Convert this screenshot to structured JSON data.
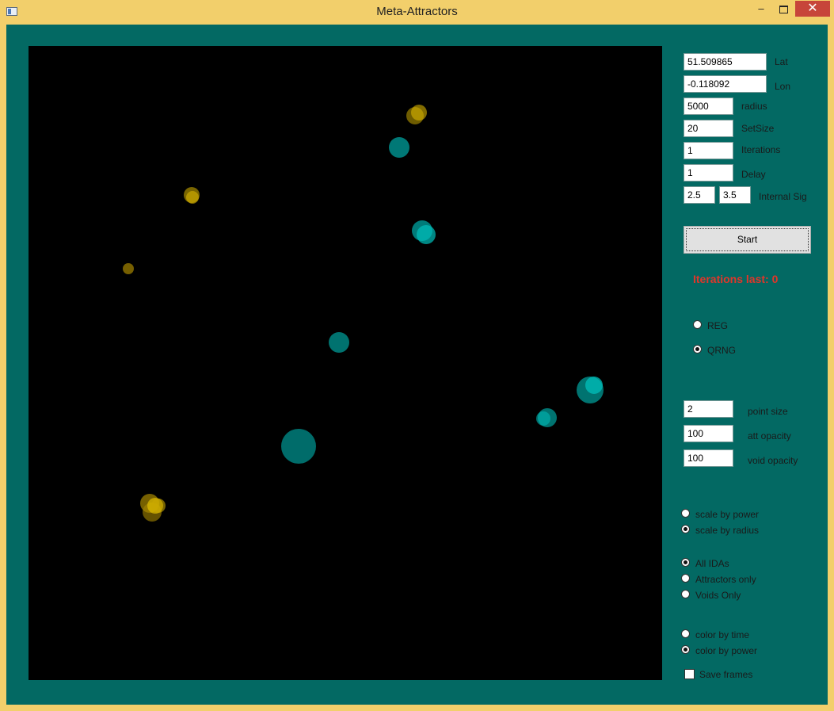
{
  "window": {
    "title": "Meta-Attractors",
    "minimize": "–",
    "close": "✕"
  },
  "colors": {
    "background": "#036963",
    "attractor": "#d4b000",
    "void": "#00b3b0",
    "error_text": "#e0362a"
  },
  "inputs": {
    "lat": {
      "value": "51.509865",
      "label": "Lat"
    },
    "lon": {
      "value": "-0.118092",
      "label": "Lon"
    },
    "radius": {
      "value": "5000",
      "label": "radius"
    },
    "setsize": {
      "value": "20",
      "label": "SetSize"
    },
    "iterations": {
      "value": "1",
      "label": "Iterations"
    },
    "delay": {
      "value": "1",
      "label": "Delay"
    },
    "internal_sig": {
      "value1": "2.5",
      "value2": "3.5",
      "label": "Internal Sig"
    }
  },
  "start_label": "Start",
  "iterations_last": "Iterations last: 0",
  "rng": {
    "reg": "REG",
    "qrng": "QRNG",
    "selected": "QRNG"
  },
  "display": {
    "point_size": {
      "value": "2",
      "label": "point size"
    },
    "att_opacity": {
      "value": "100",
      "label": "att opacity"
    },
    "void_opacity": {
      "value": "100",
      "label": "void opacity"
    }
  },
  "scale": {
    "power": "scale by power",
    "radius": "scale by radius",
    "selected": "scale by radius"
  },
  "filter": {
    "all": "All IDAs",
    "attractors": "Attractors only",
    "voids": "Voids Only",
    "selected": "All IDAs"
  },
  "color_mode": {
    "time": "color by time",
    "power": "color by power",
    "selected": "color by power"
  },
  "save_frames": {
    "label": "Save frames",
    "checked": false
  }
}
